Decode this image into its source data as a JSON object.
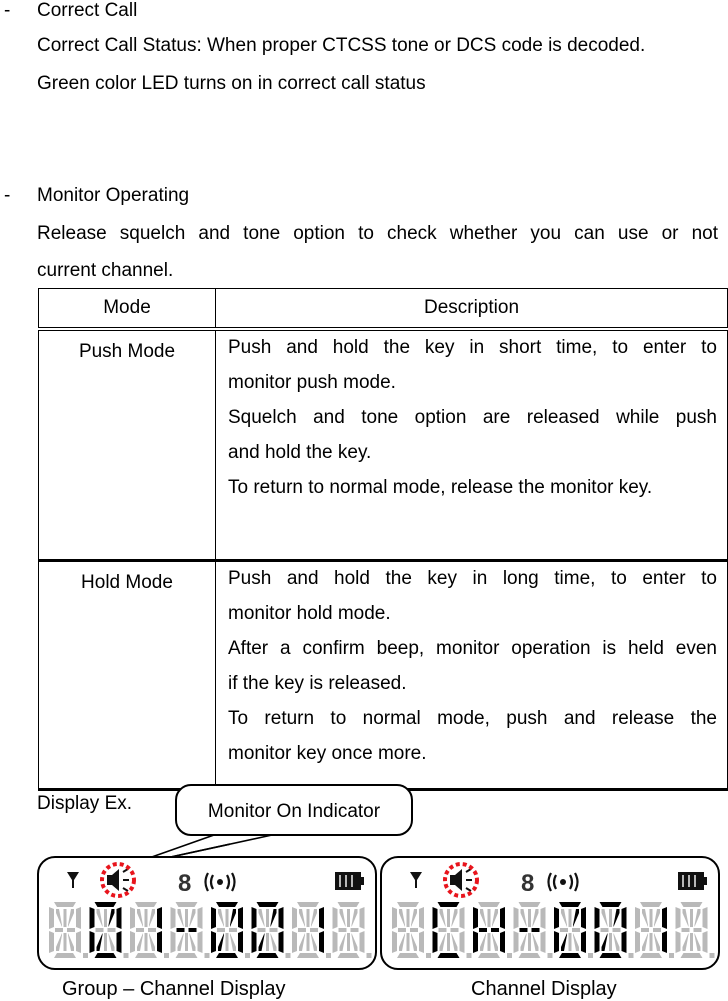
{
  "sections": {
    "correct_call": {
      "bullet": "-",
      "title": "Correct Call",
      "lines": [
        "Correct Call Status: When proper CTCSS tone or DCS code is decoded.",
        "Green color LED turns on in correct call status"
      ]
    },
    "monitor": {
      "bullet": "-",
      "title": "Monitor Operating",
      "lines": [
        "Release squelch and tone option to check whether you can use or not",
        "current channel."
      ]
    }
  },
  "table": {
    "headers": [
      "Mode",
      "Description"
    ],
    "rows": [
      {
        "mode": "Push Mode",
        "description": [
          "Push and hold the key in short time, to enter to",
          "monitor push mode.",
          "Squelch and tone option are released while push",
          "and hold the key.",
          "To return to normal mode, release the monitor key."
        ]
      },
      {
        "mode": "Hold Mode",
        "description": [
          "Push and hold the key in long time, to enter to",
          "monitor hold mode.",
          "After a confirm beep, monitor operation is held even",
          "if the key is released.",
          "To return to normal mode, push and release the",
          "monitor key once more."
        ]
      }
    ]
  },
  "display_example": {
    "label": "Display Ex.",
    "callout": "Monitor On Indicator",
    "highlight_color": "#e8141c",
    "displays": [
      {
        "caption": "Group – Channel Display",
        "text": " 01-001 ",
        "icons": [
          "antenna-icon",
          "speaker-icon",
          "key-lock-icon",
          "vibrate-icon",
          "battery-icon"
        ]
      },
      {
        "caption": "Channel Display",
        "text": " CH-001 ",
        "icons": [
          "antenna-icon",
          "speaker-icon",
          "key-lock-icon",
          "vibrate-icon",
          "battery-icon"
        ]
      }
    ]
  }
}
